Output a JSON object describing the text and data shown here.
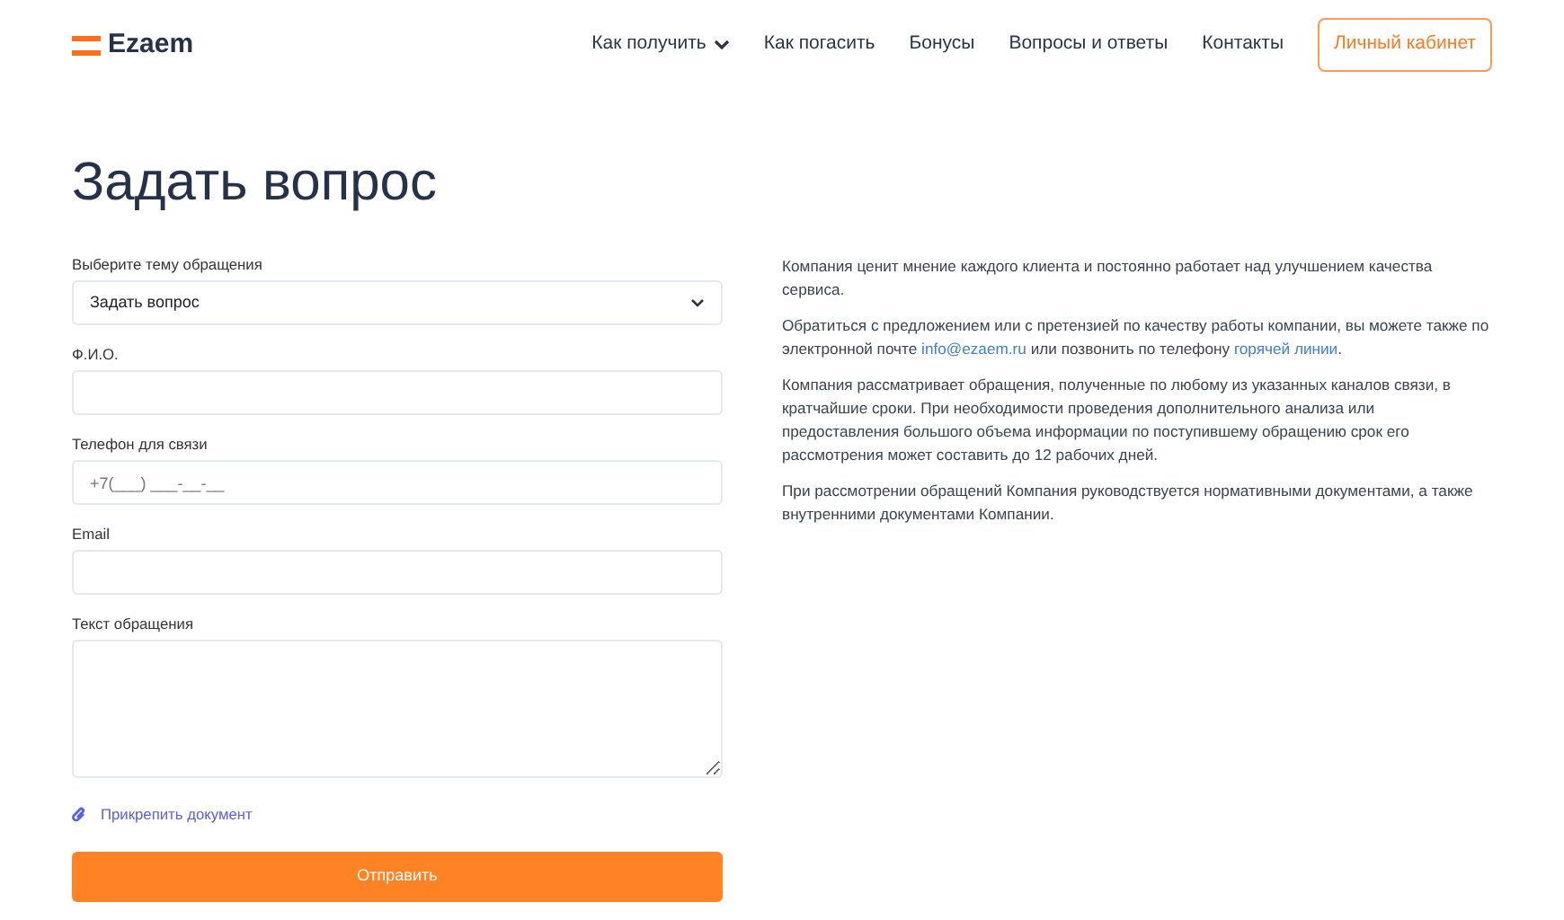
{
  "header": {
    "logo": "Ezaem",
    "nav": [
      {
        "label": "Как получить",
        "dropdown": true
      },
      {
        "label": "Как погасить",
        "dropdown": false
      },
      {
        "label": "Бонусы",
        "dropdown": false
      },
      {
        "label": "Вопросы и ответы",
        "dropdown": false
      },
      {
        "label": "Контакты",
        "dropdown": false
      }
    ],
    "account_button": "Личный кабинет"
  },
  "title": "Задать вопрос",
  "form": {
    "fields": [
      {
        "kind": "select",
        "label": "Выберите тему обращения",
        "value": "Задать вопрос"
      },
      {
        "kind": "input",
        "label": "Ф.И.О."
      },
      {
        "kind": "input",
        "label": "Телефон для связи",
        "placeholder": "+7(___) ___-__-__"
      },
      {
        "kind": "input",
        "label": "Email"
      },
      {
        "kind": "textarea",
        "label": "Текст обращения"
      }
    ],
    "attach_link": "Прикрепить документ",
    "submit": "Отправить"
  },
  "info": [
    [
      {
        "text": "Компания ценит мнение каждого клиента и постоянно работает над улучшением качества сервиса."
      }
    ],
    [
      {
        "text": "Обратиться с предложением или с претензией по качеству работы компании, вы можете также по электронной почте "
      },
      {
        "link": "info@ezaem.ru"
      },
      {
        "text": " или позвонить по телефону "
      },
      {
        "link": "горячей линии"
      },
      {
        "text": "."
      }
    ],
    [
      {
        "text": "Компания рассматривает обращения, полученные по любому из указанных каналов связи, в кратчайшие сроки. При необходимости проведения дополнительного анализа или предоставления большого объема информации по поступившему обращению срок его рассмотрения может составить до 12 рабочих дней."
      }
    ],
    [
      {
        "text": "При рассмотрении обращений Компания руководствуется нормативными документами, а также внутренними документами Компании."
      }
    ]
  ]
}
